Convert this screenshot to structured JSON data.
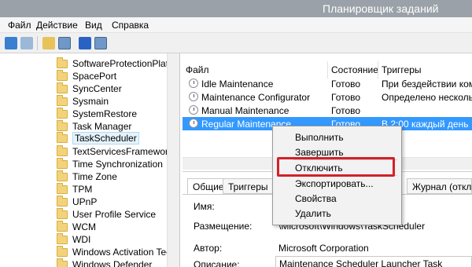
{
  "window": {
    "title": "Планировщик заданий"
  },
  "menu": {
    "items": [
      "Файл",
      "Действие",
      "Вид",
      "Справка"
    ]
  },
  "tree": {
    "items": [
      "SoftwareProtectionPlatfor",
      "SpacePort",
      "SyncCenter",
      "Sysmain",
      "SystemRestore",
      "Task Manager",
      "TaskScheduler",
      "TextServicesFramework",
      "Time Synchronization",
      "Time Zone",
      "TPM",
      "UPnP",
      "User Profile Service",
      "WCM",
      "WDI",
      "Windows Activation Techi",
      "Windows Defender"
    ],
    "selected": "TaskScheduler"
  },
  "table": {
    "headers": [
      "Файл",
      "Состояние",
      "Триггеры"
    ],
    "rows": [
      {
        "name": "Idle Maintenance",
        "status": "Готово",
        "trigger": "При бездействии компь"
      },
      {
        "name": "Maintenance Configurator",
        "status": "Готово",
        "trigger": "Определено несколько"
      },
      {
        "name": "Manual Maintenance",
        "status": "Готово",
        "trigger": ""
      },
      {
        "name": "Regular Maintenance",
        "status": "Готово",
        "trigger": "В 2:00 каждый день"
      }
    ],
    "selected_row": "Regular Maintenance"
  },
  "context_menu": {
    "items": [
      "Выполнить",
      "Завершить",
      "Отключить",
      "Экспортировать...",
      "Свойства",
      "Удалить"
    ],
    "highlighted": "Отключить"
  },
  "details": {
    "tabs": [
      "Общие",
      "Триггеры",
      "Журнал (отклю"
    ],
    "fields": {
      "name_label": "Имя:",
      "location_label": "Размещение:",
      "location_value": "\\Microsoft\\Windows\\TaskScheduler",
      "author_label": "Автор:",
      "author_value": "Microsoft Corporation",
      "description_label": "Описание:",
      "description_value": "Maintenance Scheduler Launcher Task"
    }
  },
  "colors": {
    "selection": "#3399ff",
    "highlight_box": "#d3202a",
    "titlebar": "#9aa1a8"
  }
}
